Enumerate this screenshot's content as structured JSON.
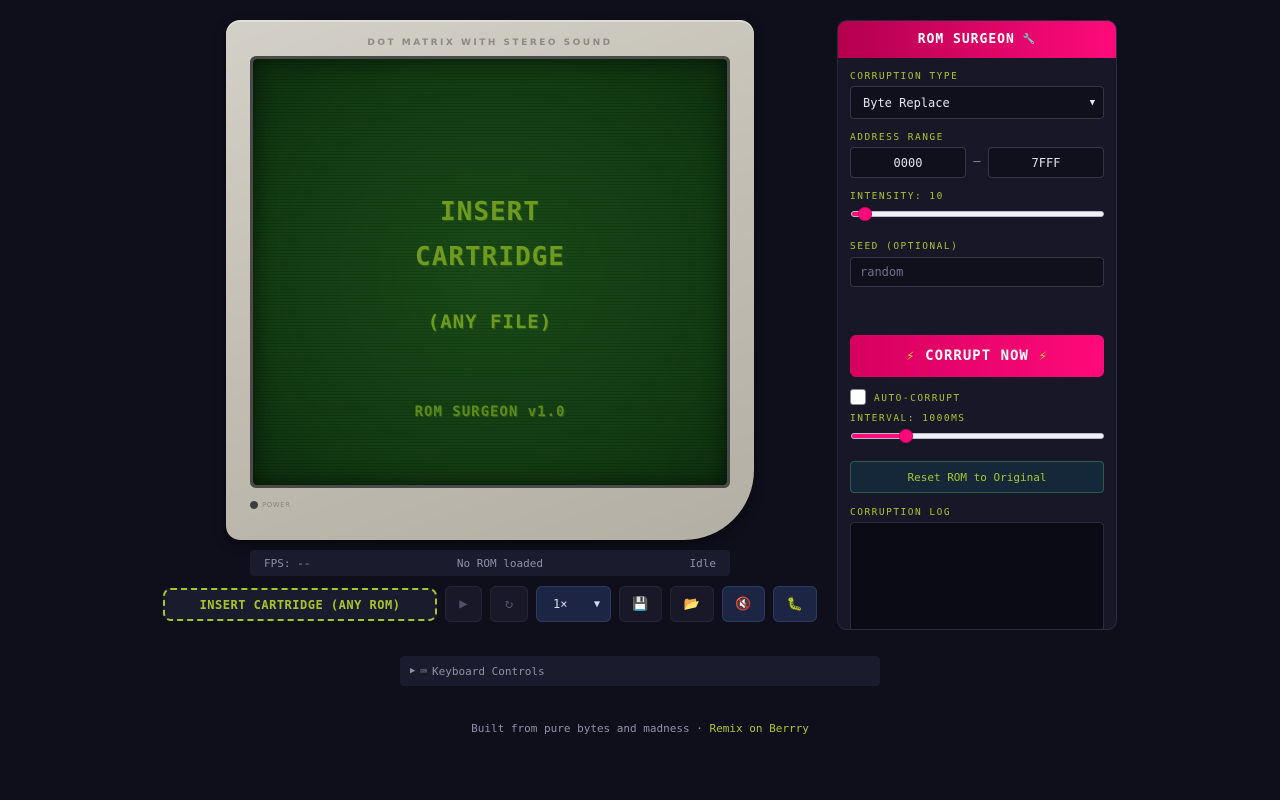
{
  "console": {
    "label": "DOT MATRIX WITH STEREO SOUND",
    "screen_line1": "INSERT",
    "screen_line2": "CARTRIDGE",
    "screen_line3": "(ANY FILE)",
    "screen_line4": "ROM SURGEON v1.0",
    "power_label": "POWER"
  },
  "status": {
    "fps": "FPS: --",
    "rom": "No ROM loaded",
    "state": "Idle"
  },
  "controls": {
    "insert_label": "INSERT CARTRIDGE (ANY ROM)",
    "play_icon": "▶",
    "reset_icon": "↻",
    "speed_value": "1×",
    "save_icon": "💾",
    "load_icon": "📂",
    "mute_icon": "🔇",
    "debug_icon": "🐛"
  },
  "keyboard": {
    "arrow": "▶",
    "icon": "⌨",
    "label": "Keyboard Controls"
  },
  "footer": {
    "text": "Built from pure bytes and madness · ",
    "link": "Remix on Berrry"
  },
  "panel": {
    "title": "ROM SURGEON",
    "title_icon": "🔧",
    "corruption_type_label": "CORRUPTION TYPE",
    "corruption_type_value": "Byte Replace",
    "address_range_label": "ADDRESS RANGE",
    "address_start": "0000",
    "address_sep": "—",
    "address_end": "7FFF",
    "intensity_label": "INTENSITY: 10",
    "intensity_fraction": 0.04,
    "seed_label": "SEED (OPTIONAL)",
    "seed_placeholder": "random",
    "corrupt_label": "CORRUPT NOW",
    "bolt_icon": "⚡",
    "auto_corrupt_label": "AUTO-CORRUPT",
    "interval_label": "INTERVAL: 1000MS",
    "interval_fraction": 0.2,
    "reset_label": "Reset ROM to Original",
    "log_label": "CORRUPTION LOG"
  },
  "colors": {
    "accent_pink": "#ff0a7a",
    "accent_green": "#a6c52a",
    "screen_green": "#123b12"
  }
}
